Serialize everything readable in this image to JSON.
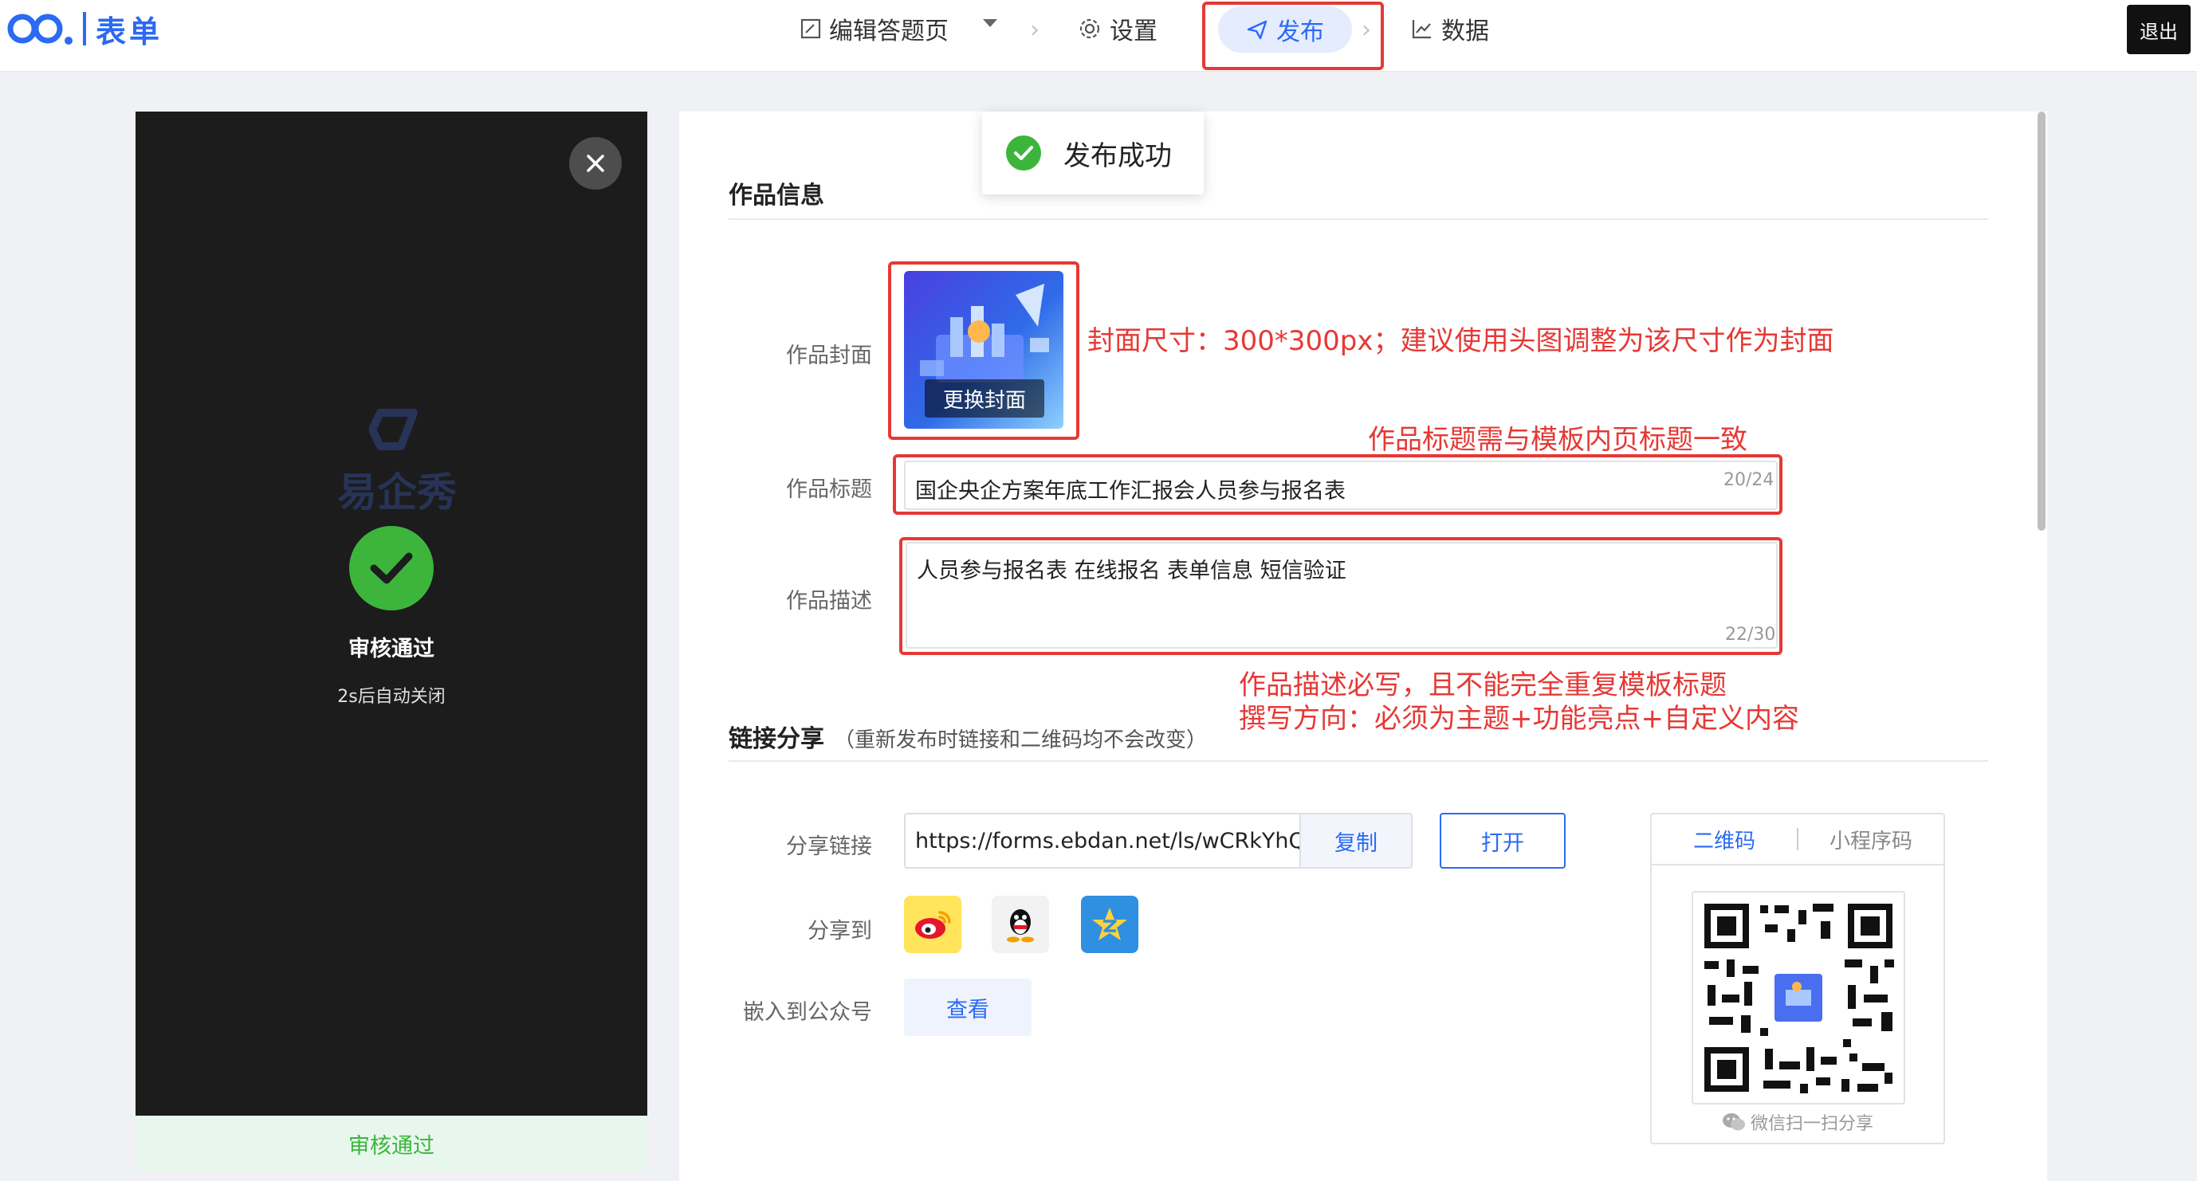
{
  "header": {
    "logo_text": "表单",
    "nav": {
      "edit": "编辑答题页",
      "settings": "设置",
      "publish": "发布",
      "data": "数据"
    },
    "exit": "退出"
  },
  "preview": {
    "watermark": "易企秀",
    "status_title": "审核通过",
    "status_sub": "2s后自动关闭",
    "status_bar": "审核通过"
  },
  "toast": {
    "text": "发布成功"
  },
  "work_info": {
    "title": "作品信息",
    "cover_label": "作品封面",
    "cover_button": "更换封面",
    "title_label": "作品标题",
    "title_value": "国企央企方案年底工作汇报会人员参与报名表",
    "title_count": "20/24",
    "desc_label": "作品描述",
    "desc_value": "人员参与报名表 在线报名 表单信息 短信验证",
    "desc_count": "22/30"
  },
  "annotations": {
    "cover_note": "封面尺寸：300*300px；建议使用头图调整为该尺寸作为封面",
    "title_note": "作品标题需与模板内页标题一致",
    "desc_note_1": "作品描述必写，且不能完全重复模板标题",
    "desc_note_2": "撰写方向：必须为主题+功能亮点+自定义内容"
  },
  "link_share": {
    "title": "链接分享",
    "note": "（重新发布时链接和二维码均不会改变）",
    "link_label": "分享链接",
    "link_value": "https://forms.ebdan.net/ls/wCRkYhQl",
    "copy": "复制",
    "open": "打开",
    "share_label": "分享到",
    "share_targets": [
      "weibo-icon",
      "qq-icon",
      "qzone-icon"
    ],
    "embed_label": "嵌入到公众号",
    "view": "查看"
  },
  "qr": {
    "tab_qr": "二维码",
    "tab_miniprogram": "小程序码",
    "caption": "微信扫一扫分享"
  },
  "colors": {
    "brand": "#2b6af3",
    "annotation": "#e53935",
    "success": "#3db53d"
  }
}
